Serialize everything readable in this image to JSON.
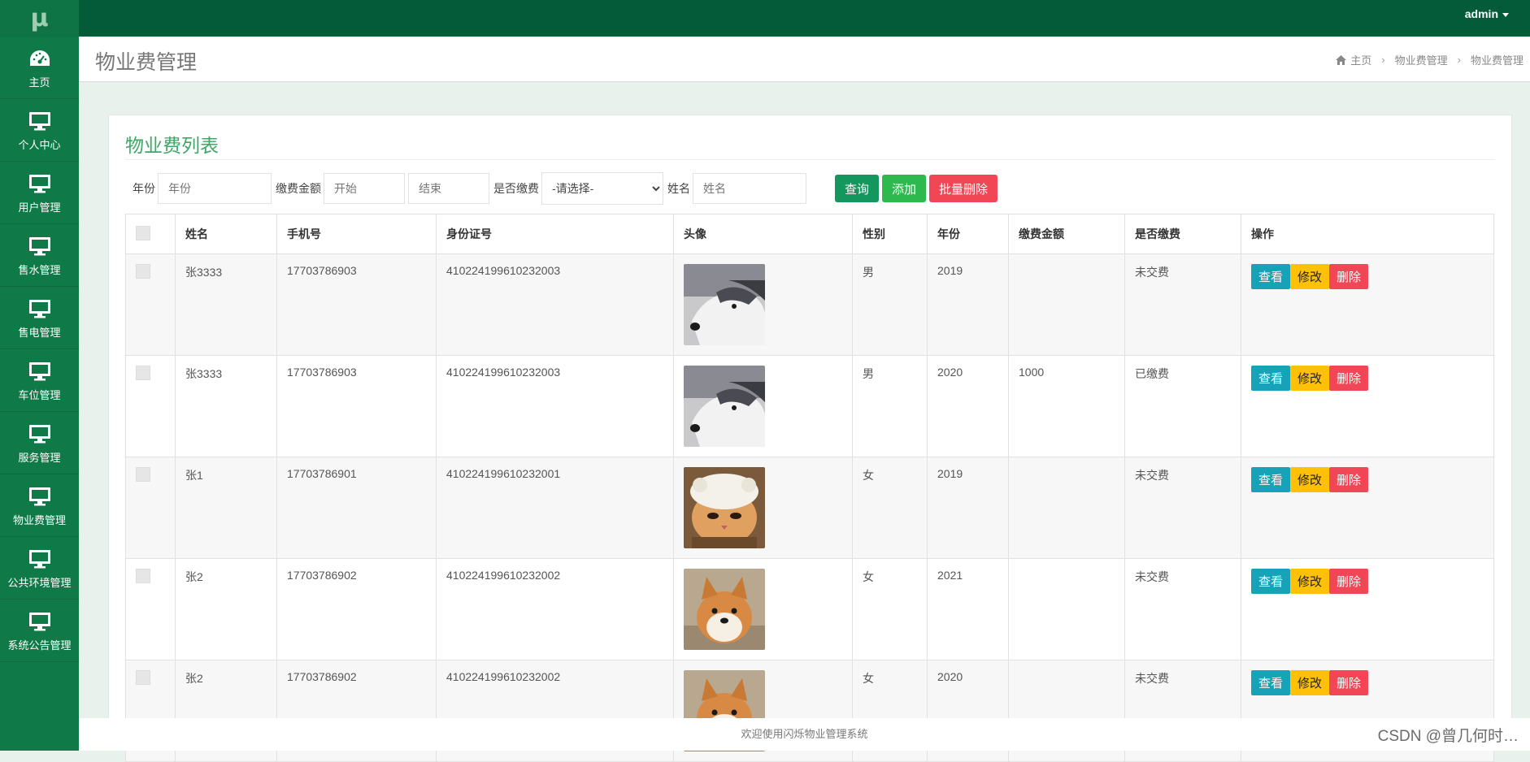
{
  "logo": "μ",
  "user": {
    "name": "admin"
  },
  "sidebar": {
    "items": [
      {
        "label": "主页",
        "icon": "dashboard-icon"
      },
      {
        "label": "个人中心",
        "icon": "monitor-icon"
      },
      {
        "label": "用户管理",
        "icon": "monitor-icon"
      },
      {
        "label": "售水管理",
        "icon": "monitor-icon"
      },
      {
        "label": "售电管理",
        "icon": "monitor-icon"
      },
      {
        "label": "车位管理",
        "icon": "monitor-icon"
      },
      {
        "label": "服务管理",
        "icon": "monitor-icon"
      },
      {
        "label": "物业费管理",
        "icon": "monitor-icon"
      },
      {
        "label": "公共环境管理",
        "icon": "monitor-icon"
      },
      {
        "label": "系统公告管理",
        "icon": "monitor-icon"
      }
    ]
  },
  "header": {
    "title": "物业费管理",
    "breadcrumb": [
      "主页",
      "物业费管理",
      "物业费管理"
    ]
  },
  "panel": {
    "title": "物业费列表"
  },
  "search": {
    "year_label": "年份",
    "year_placeholder": "年份",
    "amount_label": "缴费金额",
    "start_placeholder": "开始",
    "end_placeholder": "结束",
    "paid_label": "是否缴费",
    "paid_selected": "-请选择-",
    "name_label": "姓名",
    "name_placeholder": "姓名",
    "query_button": "查询",
    "add_button": "添加",
    "batch_delete_button": "批量删除"
  },
  "table": {
    "columns": [
      "姓名",
      "手机号",
      "身份证号",
      "头像",
      "性别",
      "年份",
      "缴费金额",
      "是否缴费",
      "操作"
    ],
    "actions": {
      "view": "查看",
      "edit": "修改",
      "delete": "删除"
    },
    "rows": [
      {
        "name": "张3333",
        "phone": "17703786903",
        "id_card": "410224199610232003",
        "avatar": "husky",
        "gender": "男",
        "year": "2019",
        "amount": "",
        "paid": "未交费"
      },
      {
        "name": "张3333",
        "phone": "17703786903",
        "id_card": "410224199610232003",
        "avatar": "husky",
        "gender": "男",
        "year": "2020",
        "amount": "1000",
        "paid": "已缴费"
      },
      {
        "name": "张1",
        "phone": "17703786901",
        "id_card": "410224199610232001",
        "avatar": "cat",
        "gender": "女",
        "year": "2019",
        "amount": "",
        "paid": "未交费"
      },
      {
        "name": "张2",
        "phone": "17703786902",
        "id_card": "410224199610232002",
        "avatar": "shiba",
        "gender": "女",
        "year": "2021",
        "amount": "",
        "paid": "未交费"
      },
      {
        "name": "张2",
        "phone": "17703786902",
        "id_card": "410224199610232002",
        "avatar": "shiba",
        "gender": "女",
        "year": "2020",
        "amount": "",
        "paid": "未交费"
      }
    ]
  },
  "footer": {
    "text": "欢迎使用闪烁物业管理系统"
  },
  "watermark": "CSDN @曾几何时…",
  "colors": {
    "sidebar": "#0f7a48",
    "topbar": "#035b39",
    "accent": "#3ea767"
  }
}
